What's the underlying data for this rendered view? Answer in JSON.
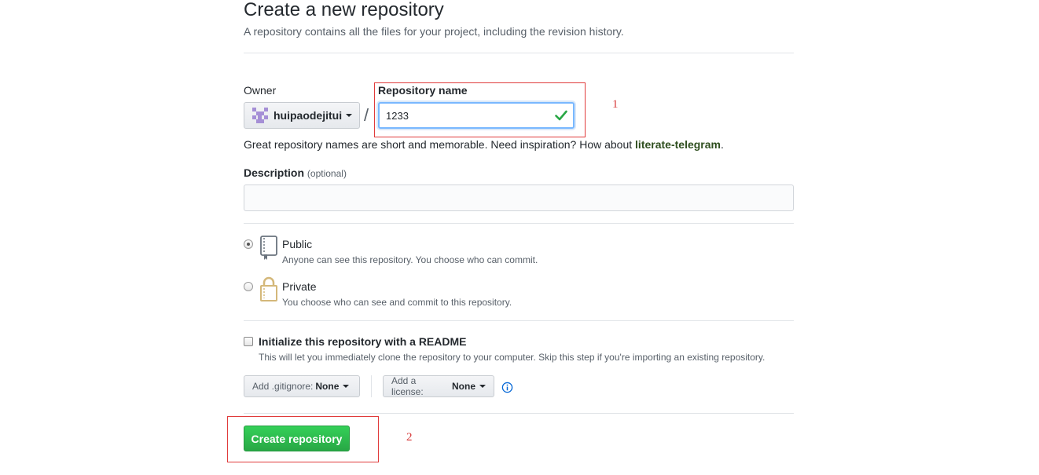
{
  "header": {
    "title": "Create a new repository",
    "subtitle": "A repository contains all the files for your project, including the revision history."
  },
  "owner": {
    "label": "Owner",
    "name": "huipaodejitui"
  },
  "separator": "/",
  "repo_name": {
    "label": "Repository name",
    "value": "1233"
  },
  "hint": {
    "text": "Great repository names are short and memorable. Need inspiration? How about ",
    "suggestion": "literate-telegram",
    "end": "."
  },
  "description": {
    "label": "Description",
    "optional": "(optional)",
    "value": ""
  },
  "visibility": {
    "public": {
      "title": "Public",
      "desc": "Anyone can see this repository. You choose who can commit.",
      "checked": true
    },
    "private": {
      "title": "Private",
      "desc": "You choose who can see and commit to this repository.",
      "checked": false
    }
  },
  "readme": {
    "title": "Initialize this repository with a README",
    "desc": "This will let you immediately clone the repository to your computer. Skip this step if you're importing an existing repository.",
    "checked": false
  },
  "gitignore": {
    "label": "Add .gitignore:",
    "value": "None"
  },
  "license": {
    "label": "Add a license:",
    "value": "None"
  },
  "submit": {
    "label": "Create repository"
  },
  "annotations": {
    "first": "1",
    "second": "2"
  },
  "colors": {
    "accent_green": "#28a745",
    "annotation_red": "#e03b3b",
    "link_blue": "#0366d6"
  }
}
